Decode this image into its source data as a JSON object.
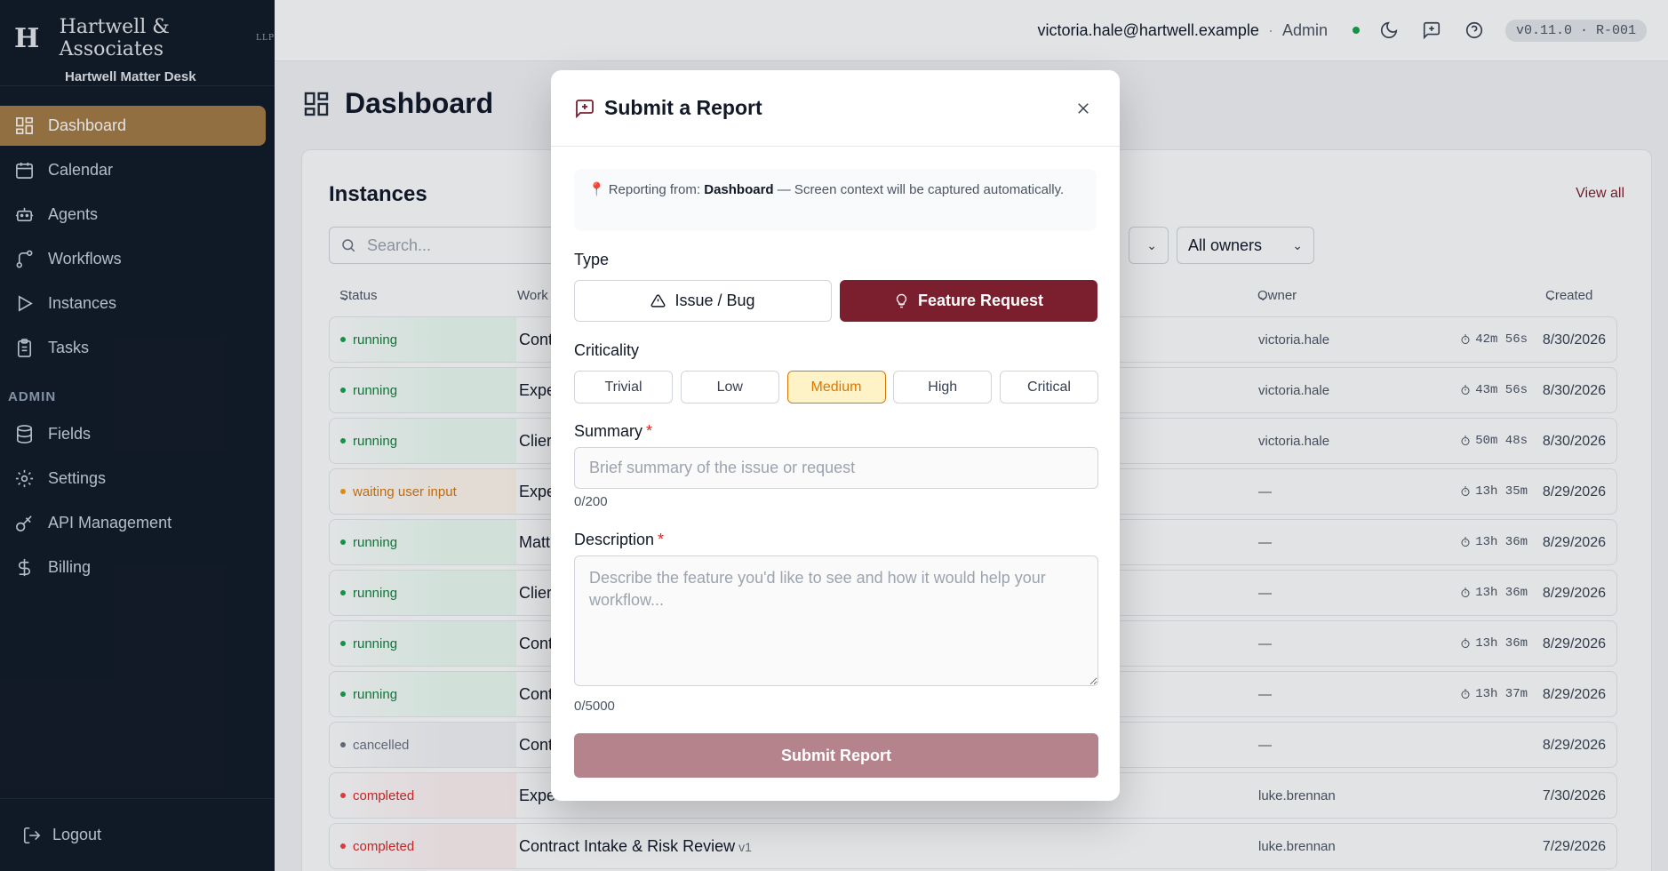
{
  "brand": {
    "logo": "H",
    "name": "Hartwell & Associates",
    "suffix": "LLP",
    "subtitle": "Hartwell Matter Desk"
  },
  "sidebar": {
    "items": [
      {
        "label": "Dashboard",
        "icon": "dashboard-icon",
        "active": true
      },
      {
        "label": "Calendar",
        "icon": "calendar-icon"
      },
      {
        "label": "Agents",
        "icon": "robot-icon"
      },
      {
        "label": "Workflows",
        "icon": "workflow-icon"
      },
      {
        "label": "Instances",
        "icon": "play-icon"
      },
      {
        "label": "Tasks",
        "icon": "clipboard-icon"
      }
    ],
    "admin_heading": "ADMIN",
    "admin_items": [
      {
        "label": "Fields",
        "icon": "database-icon"
      },
      {
        "label": "Settings",
        "icon": "gear-icon"
      },
      {
        "label": "API Management",
        "icon": "key-icon"
      },
      {
        "label": "Billing",
        "icon": "dollar-icon"
      }
    ],
    "logout": "Logout"
  },
  "topbar": {
    "email": "victoria.hale@hartwell.example",
    "separator": "·",
    "role": "Admin",
    "version": "v0.11.0 · R-001"
  },
  "page": {
    "title": "Dashboard"
  },
  "instances": {
    "title": "Instances",
    "view_all": "View all",
    "search_placeholder": "Search...",
    "owner_filter": "All owners",
    "columns": {
      "status": "Status",
      "workflow": "Work",
      "owner": "Owner",
      "created": "Created"
    },
    "rows": [
      {
        "status": "running",
        "kind": "running",
        "workflow": "Cont",
        "version": "",
        "owner": "victoria.hale",
        "duration": "42m 56s",
        "created": "8/30/2026"
      },
      {
        "status": "running",
        "kind": "running",
        "workflow": "Expe",
        "version": "",
        "owner": "victoria.hale",
        "duration": "43m 56s",
        "created": "8/30/2026"
      },
      {
        "status": "running",
        "kind": "running",
        "workflow": "Clier",
        "version": "",
        "owner": "victoria.hale",
        "duration": "50m 48s",
        "created": "8/30/2026"
      },
      {
        "status": "waiting user input",
        "kind": "waiting",
        "workflow": "Expe",
        "version": "",
        "owner": "—",
        "duration": "13h 35m",
        "created": "8/29/2026"
      },
      {
        "status": "running",
        "kind": "running",
        "workflow": "Matt",
        "version": "",
        "owner": "—",
        "duration": "13h 36m",
        "created": "8/29/2026"
      },
      {
        "status": "running",
        "kind": "running",
        "workflow": "Clier",
        "version": "",
        "owner": "—",
        "duration": "13h 36m",
        "created": "8/29/2026"
      },
      {
        "status": "running",
        "kind": "running",
        "workflow": "Cont",
        "version": "",
        "owner": "—",
        "duration": "13h 36m",
        "created": "8/29/2026"
      },
      {
        "status": "running",
        "kind": "running",
        "workflow": "Cont",
        "version": "",
        "owner": "—",
        "duration": "13h 37m",
        "created": "8/29/2026"
      },
      {
        "status": "cancelled",
        "kind": "cancelled",
        "workflow": "Cont",
        "version": "",
        "owner": "—",
        "duration": "",
        "created": "8/29/2026"
      },
      {
        "status": "completed",
        "kind": "completed",
        "workflow": "Expe",
        "version": "",
        "owner": "luke.brennan",
        "duration": "",
        "created": "7/30/2026"
      },
      {
        "status": "completed",
        "kind": "completed",
        "workflow": "Contract Intake & Risk Review",
        "version": "v1",
        "owner": "luke.brennan",
        "duration": "",
        "created": "7/29/2026"
      }
    ]
  },
  "modal": {
    "title": "Submit a Report",
    "context_prefix": "Reporting from:",
    "context_page": "Dashboard",
    "context_suffix": "— Screen context will be captured automatically.",
    "type_label": "Type",
    "type_bug": "Issue / Bug",
    "type_feature": "Feature Request",
    "selected_type": "Feature Request",
    "criticality_label": "Criticality",
    "criticality_options": [
      "Trivial",
      "Low",
      "Medium",
      "High",
      "Critical"
    ],
    "selected_criticality": "Medium",
    "summary_label": "Summary",
    "required_mark": "*",
    "summary_placeholder": "Brief summary of the issue or request",
    "summary_value": "",
    "summary_counter": "0/200",
    "description_label": "Description",
    "description_placeholder": "Describe the feature you'd like to see and how it would help your workflow...",
    "description_value": "",
    "description_counter": "0/5000",
    "submit_label": "Submit Report"
  },
  "colors": {
    "sidebar_bg": "#111a26",
    "active_nav": "#a47c45",
    "primary": "#7b1e2e",
    "submit_disabled": "#b5838c",
    "medium_accent": "#d97706"
  }
}
